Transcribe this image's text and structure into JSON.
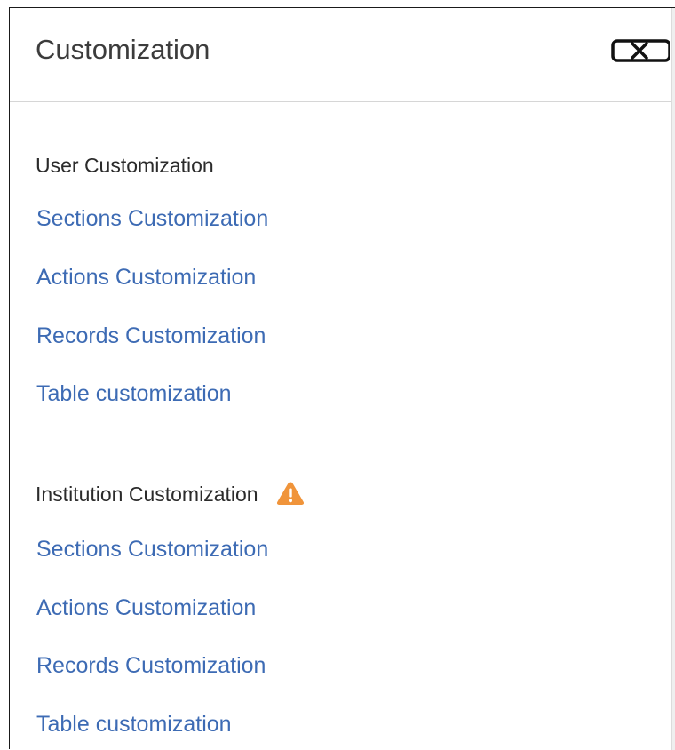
{
  "panel": {
    "title": "Customization",
    "close_icon": "close-icon"
  },
  "sections": [
    {
      "heading": "User Customization",
      "warning": false,
      "links": [
        "Sections Customization",
        "Actions Customization",
        "Records Customization",
        "Table customization"
      ]
    },
    {
      "heading": "Institution Customization",
      "warning": true,
      "warning_icon": "warning-icon",
      "warning_color": "#f0943a",
      "links": [
        "Sections Customization",
        "Actions Customization",
        "Records Customization",
        "Table customization"
      ]
    }
  ],
  "colors": {
    "link": "#3d6bb4",
    "heading": "#2b2b2b",
    "title": "#3c3c3c",
    "divider": "#d6d6d6"
  }
}
